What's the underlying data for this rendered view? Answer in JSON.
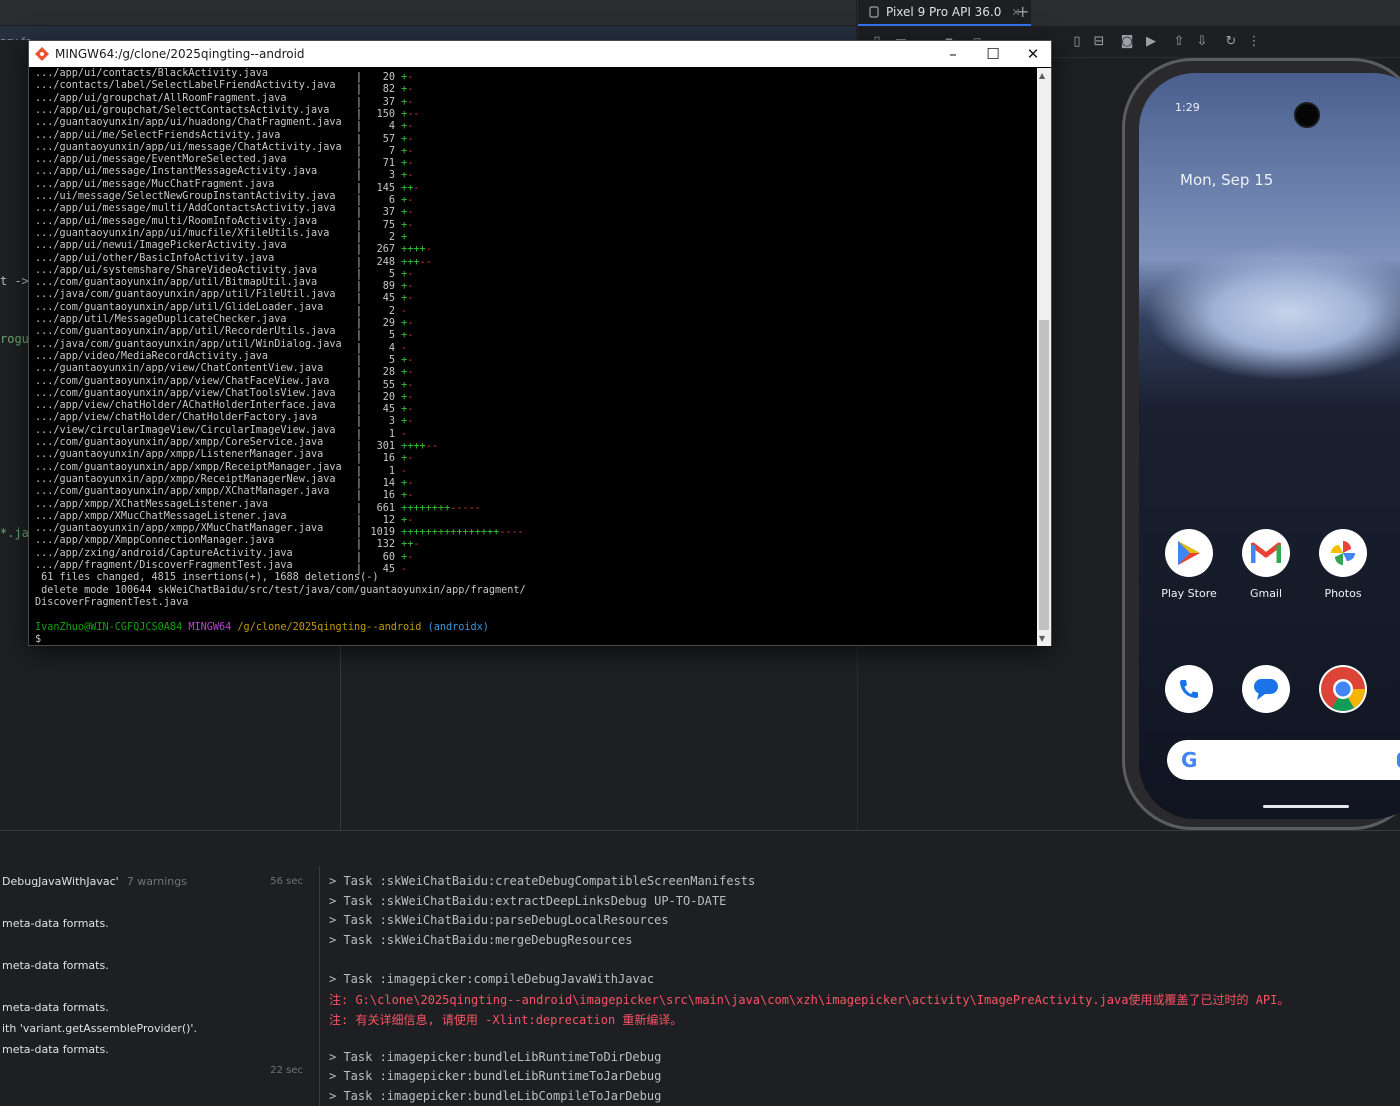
{
  "ide": {
    "tab_text": "ary fo",
    "edge_texts": [
      "t ->",
      "rogua",
      "*.ja"
    ]
  },
  "emulator": {
    "device_tab": "Pixel 9 Pro API 36.0",
    "phone": {
      "time": "1:29",
      "date": "Mon, Sep 15",
      "apps_row1": [
        {
          "label": "Play Store",
          "icon": "play-store-icon",
          "color": "#34a853"
        },
        {
          "label": "Gmail",
          "icon": "gmail-icon",
          "color": "#ea4335"
        },
        {
          "label": "Photos",
          "icon": "photos-icon",
          "color": "#fbbc04"
        }
      ],
      "apps_row2": [
        {
          "icon": "phone-app-icon",
          "color": "#1a73e8"
        },
        {
          "icon": "messages-icon",
          "color": "#1a73e8"
        },
        {
          "icon": "chrome-icon",
          "color": "#34a853"
        }
      ]
    }
  },
  "terminal": {
    "title": "MINGW64:/g/clone/2025qingting--android",
    "rows": [
      {
        "path": ".../app/ui/contacts/BlackActivity.java",
        "count": "20",
        "plus": "+",
        "minus": "-"
      },
      {
        "path": ".../contacts/label/SelectLabelFriendActivity.java",
        "count": "82",
        "plus": "+",
        "minus": "-"
      },
      {
        "path": ".../app/ui/groupchat/AllRoomFragment.java",
        "count": "37",
        "plus": "+",
        "minus": "-"
      },
      {
        "path": ".../app/ui/groupchat/SelectContactsActivity.java",
        "count": "150",
        "plus": "+",
        "minus": "--"
      },
      {
        "path": ".../guantaoyunxin/app/ui/huadong/ChatFragment.java",
        "count": "4",
        "plus": "+",
        "minus": "-"
      },
      {
        "path": ".../app/ui/me/SelectFriendsActivity.java",
        "count": "57",
        "plus": "+",
        "minus": "-"
      },
      {
        "path": ".../guantaoyunxin/app/ui/message/ChatActivity.java",
        "count": "7",
        "plus": "+",
        "minus": "-"
      },
      {
        "path": ".../app/ui/message/EventMoreSelected.java",
        "count": "71",
        "plus": "+",
        "minus": "-"
      },
      {
        "path": ".../app/ui/message/InstantMessageActivity.java",
        "count": "3",
        "plus": "+",
        "minus": "-"
      },
      {
        "path": ".../app/ui/message/MucChatFragment.java",
        "count": "145",
        "plus": "++",
        "minus": "-"
      },
      {
        "path": ".../ui/message/SelectNewGroupInstantActivity.java",
        "count": "6",
        "plus": "+",
        "minus": "-"
      },
      {
        "path": ".../app/ui/message/multi/AddContactsActivity.java",
        "count": "37",
        "plus": "+",
        "minus": "-"
      },
      {
        "path": ".../app/ui/message/multi/RoomInfoActivity.java",
        "count": "75",
        "plus": "+",
        "minus": "-"
      },
      {
        "path": ".../guantaoyunxin/app/ui/mucfile/XfileUtils.java",
        "count": "2",
        "plus": "+",
        "minus": ""
      },
      {
        "path": ".../app/ui/newui/ImagePickerActivity.java",
        "count": "267",
        "plus": "++++",
        "minus": "-"
      },
      {
        "path": ".../app/ui/other/BasicInfoActivity.java",
        "count": "248",
        "plus": "+++",
        "minus": "--"
      },
      {
        "path": ".../app/ui/systemshare/ShareVideoActivity.java",
        "count": "5",
        "plus": "+",
        "minus": "-"
      },
      {
        "path": ".../com/guantaoyunxin/app/util/BitmapUtil.java",
        "count": "89",
        "plus": "+",
        "minus": "-"
      },
      {
        "path": ".../java/com/guantaoyunxin/app/util/FileUtil.java",
        "count": "45",
        "plus": "+",
        "minus": "-"
      },
      {
        "path": ".../com/guantaoyunxin/app/util/GlideLoader.java",
        "count": "2",
        "plus": "",
        "minus": "-"
      },
      {
        "path": ".../app/util/MessageDuplicateChecker.java",
        "count": "29",
        "plus": "+",
        "minus": "-"
      },
      {
        "path": ".../com/guantaoyunxin/app/util/RecorderUtils.java",
        "count": "5",
        "plus": "+",
        "minus": "-"
      },
      {
        "path": ".../java/com/guantaoyunxin/app/util/WinDialog.java",
        "count": "4",
        "plus": "",
        "minus": "-"
      },
      {
        "path": ".../app/video/MediaRecordActivity.java",
        "count": "5",
        "plus": "+",
        "minus": "-"
      },
      {
        "path": ".../guantaoyunxin/app/view/ChatContentView.java",
        "count": "28",
        "plus": "+",
        "minus": "-"
      },
      {
        "path": ".../com/guantaoyunxin/app/view/ChatFaceView.java",
        "count": "55",
        "plus": "+",
        "minus": "-"
      },
      {
        "path": ".../com/guantaoyunxin/app/view/ChatToolsView.java",
        "count": "20",
        "plus": "+",
        "minus": "-"
      },
      {
        "path": ".../app/view/chatHolder/AChatHolderInterface.java",
        "count": "45",
        "plus": "+",
        "minus": "-"
      },
      {
        "path": ".../app/view/chatHolder/ChatHolderFactory.java",
        "count": "3",
        "plus": "+",
        "minus": "-"
      },
      {
        "path": ".../view/circularImageView/CircularImageView.java",
        "count": "1",
        "plus": "",
        "minus": "-"
      },
      {
        "path": ".../com/guantaoyunxin/app/xmpp/CoreService.java",
        "count": "301",
        "plus": "++++",
        "minus": "--"
      },
      {
        "path": ".../guantaoyunxin/app/xmpp/ListenerManager.java",
        "count": "16",
        "plus": "+",
        "minus": "-"
      },
      {
        "path": ".../com/guantaoyunxin/app/xmpp/ReceiptManager.java",
        "count": "1",
        "plus": "",
        "minus": "-"
      },
      {
        "path": ".../guantaoyunxin/app/xmpp/ReceiptManagerNew.java",
        "count": "14",
        "plus": "+",
        "minus": "-"
      },
      {
        "path": ".../com/guantaoyunxin/app/xmpp/XChatManager.java",
        "count": "16",
        "plus": "+",
        "minus": "-"
      },
      {
        "path": ".../app/xmpp/XChatMessageListener.java",
        "count": "661",
        "plus": "++++++++",
        "minus": "-----"
      },
      {
        "path": ".../app/xmpp/XMucChatMessageListener.java",
        "count": "12",
        "plus": "+",
        "minus": "-"
      },
      {
        "path": ".../guantaoyunxin/app/xmpp/XMucChatManager.java",
        "count": "1019",
        "plus": "++++++++++++++++",
        "minus": "----"
      },
      {
        "path": ".../app/xmpp/XmppConnectionManager.java",
        "count": "132",
        "plus": "++",
        "minus": "-"
      },
      {
        "path": ".../app/zxing/android/CaptureActivity.java",
        "count": "60",
        "plus": "+",
        "minus": "-"
      },
      {
        "path": ".../app/fragment/DiscoverFragmentTest.java",
        "count": "45",
        "plus": "",
        "minus": "-"
      }
    ],
    "summary": " 61 files changed, 4815 insertions(+), 1688 deletions(-)",
    "delete_line": " delete mode 100644 skWeiChatBaidu/src/test/java/com/guantaoyunxin/app/fragment/",
    "delete_line2": "DiscoverFragmentTest.java",
    "prompt_user": "IvanZhuo@WIN-CGFQJCS0A84",
    "prompt_sys": "MINGW64",
    "prompt_path": "/g/clone/2025qingting--android",
    "prompt_branch": "(androidx)",
    "prompt_symbol": "$"
  },
  "build": {
    "items": [
      {
        "text": "DebugJavaWithJavac'",
        "note": "7 warnings",
        "time": "56 sec"
      },
      {
        "text": "meta-data formats."
      },
      {
        "text": "meta-data formats."
      },
      {
        "text": "meta-data formats."
      },
      {
        "text": "ith 'variant.getAssembleProvider()'."
      },
      {
        "text": "meta-data formats."
      }
    ],
    "bottom_time": "22 sec",
    "output": [
      {
        "text": "> Task :skWeiChatBaidu:createDebugCompatibleScreenManifests",
        "err": false
      },
      {
        "text": "> Task :skWeiChatBaidu:extractDeepLinksDebug UP-TO-DATE",
        "err": false
      },
      {
        "text": "> Task :skWeiChatBaidu:parseDebugLocalResources",
        "err": false
      },
      {
        "text": "> Task :skWeiChatBaidu:mergeDebugResources",
        "err": false
      },
      {
        "text": "",
        "err": false
      },
      {
        "text": "> Task :imagepicker:compileDebugJavaWithJavac",
        "err": false
      },
      {
        "text": "注: G:\\clone\\2025qingting--android\\imagepicker\\src\\main\\java\\com\\xzh\\imagepicker\\activity\\ImagePreActivity.java使用或覆盖了已过时的 API。",
        "err": true
      },
      {
        "text": "注: 有关详细信息, 请使用 -Xlint:deprecation 重新编译。",
        "err": true
      },
      {
        "text": "",
        "err": false
      },
      {
        "text": "> Task :imagepicker:bundleLibRuntimeToDirDebug",
        "err": false
      },
      {
        "text": "> Task :imagepicker:bundleLibRuntimeToJarDebug",
        "err": false
      },
      {
        "text": "> Task :imagepicker:bundleLibCompileToJarDebug",
        "err": false
      }
    ]
  }
}
